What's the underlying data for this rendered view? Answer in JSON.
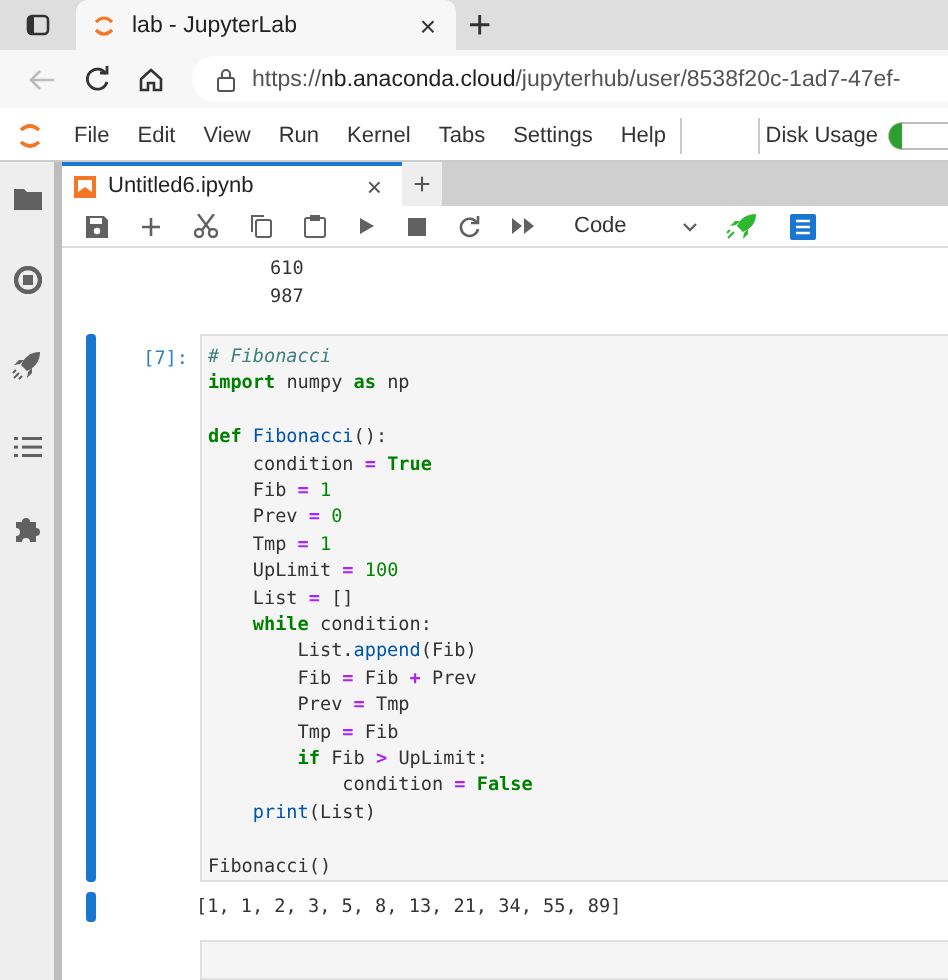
{
  "browser": {
    "tab_title": "lab - JupyterLab",
    "tab_close": "×",
    "new_tab": "+",
    "url": "https://**nb.anaconda.cloud**/jupyterhub/user/8538f20c-1ad7-47ef-"
  },
  "menu": {
    "items": [
      "File",
      "Edit",
      "View",
      "Run",
      "Kernel",
      "Tabs",
      "Settings",
      "Help"
    ],
    "disk_usage": "Disk Usage"
  },
  "notebook": {
    "tab": {
      "title": "Untitled6.ipynb",
      "close": "×"
    },
    "new_tab": "+",
    "cell_type": "Code",
    "prev_output": [
      "610",
      "987"
    ],
    "cell": {
      "prompt": "[7]:",
      "selected": true,
      "code_blocks": [
        [
          [
            {
              "text": "# Fibonacci",
              "kind": "comment"
            }
          ],
          [
            {
              "text": "import",
              "kind": "kw"
            },
            {
              "text": " numpy ",
              "kind": "plain"
            },
            {
              "text": "as",
              "kind": "kw"
            },
            {
              "text": " np",
              "kind": "plain"
            }
          ]
        ],
        [
          [
            {
              "text": "def",
              "kind": "kw"
            },
            {
              "text": " Fibonacci",
              "kind": "fn"
            },
            {
              "text": "():",
              "kind": "plain"
            }
          ],
          [
            {
              "text": "    condition ",
              "kind": "plain"
            },
            {
              "text": "=",
              "kind": "op"
            },
            {
              "text": " True",
              "kind": "kw"
            }
          ],
          [
            {
              "text": "    Fib ",
              "kind": "plain"
            },
            {
              "text": "=",
              "kind": "op"
            },
            {
              "text": " 1",
              "kind": "num"
            }
          ],
          [
            {
              "text": "    Prev ",
              "kind": "plain"
            },
            {
              "text": "=",
              "kind": "op"
            },
            {
              "text": " 0",
              "kind": "num"
            }
          ],
          [
            {
              "text": "    Tmp ",
              "kind": "plain"
            },
            {
              "text": "=",
              "kind": "op"
            },
            {
              "text": " 1",
              "kind": "num"
            }
          ],
          [
            {
              "text": "    UpLimit ",
              "kind": "plain"
            },
            {
              "text": "=",
              "kind": "op"
            },
            {
              "text": " 100",
              "kind": "num"
            }
          ],
          [
            {
              "text": "    List ",
              "kind": "plain"
            },
            {
              "text": "=",
              "kind": "op"
            },
            {
              "text": " []",
              "kind": "plain"
            }
          ],
          [
            {
              "text": "    while",
              "kind": "kw"
            },
            {
              "text": " condition:",
              "kind": "plain"
            }
          ],
          [
            {
              "text": "        List.",
              "kind": "plain"
            },
            {
              "text": "append",
              "kind": "fn"
            },
            {
              "text": "(Fib)",
              "kind": "plain"
            }
          ],
          [
            {
              "text": "        Fib ",
              "kind": "plain"
            },
            {
              "text": "=",
              "kind": "op"
            },
            {
              "text": " Fib ",
              "kind": "plain"
            },
            {
              "text": "+",
              "kind": "op"
            },
            {
              "text": " Prev",
              "kind": "plain"
            }
          ],
          [
            {
              "text": "        Prev ",
              "kind": "plain"
            },
            {
              "text": "=",
              "kind": "op"
            },
            {
              "text": " Tmp",
              "kind": "plain"
            }
          ],
          [
            {
              "text": "        Tmp ",
              "kind": "plain"
            },
            {
              "text": "=",
              "kind": "op"
            },
            {
              "text": " Fib",
              "kind": "plain"
            }
          ],
          [
            {
              "text": "        if",
              "kind": "kw"
            },
            {
              "text": " Fib ",
              "kind": "plain"
            },
            {
              "text": ">",
              "kind": "op"
            },
            {
              "text": " UpLimit:",
              "kind": "plain"
            }
          ],
          [
            {
              "text": "            condition ",
              "kind": "plain"
            },
            {
              "text": "=",
              "kind": "op"
            },
            {
              "text": " False",
              "kind": "kw"
            }
          ],
          [
            {
              "text": "    print",
              "kind": "fn"
            },
            {
              "text": "(List)",
              "kind": "plain"
            }
          ]
        ],
        [
          [
            {
              "text": "Fibonacci()",
              "kind": "plain"
            }
          ]
        ]
      ],
      "output": "[1, 1, 2, 3, 5, 8, 13, 21, 34, 55, 89]"
    }
  }
}
